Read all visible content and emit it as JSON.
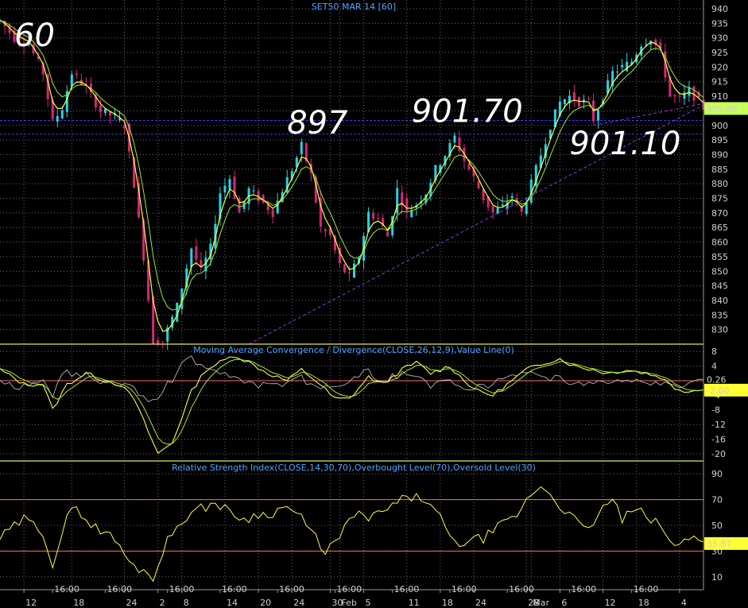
{
  "colors": {
    "background": "#000000",
    "grid": "#6a6a6a",
    "panel_border": "#e8e84a",
    "bull": "#27d3e6",
    "bear": "#d6287a",
    "ma_fast": "#ffff33",
    "ma_slow": "#9be83a",
    "signal": "#c9c9c9",
    "level_line": "#ff6a6a",
    "dashed": "#3a3af0",
    "trend": "#8a3ad9",
    "last_price_box": "#c9ff5a",
    "rsi_line": "#ffff33"
  },
  "chart_data": [
    {
      "type": "candlestick",
      "title": "SET50 MAR 14 [60]",
      "ylim": [
        825,
        943
      ],
      "yticks": [
        830,
        835,
        840,
        845,
        850,
        855,
        860,
        865,
        870,
        875,
        880,
        885,
        890,
        895,
        900,
        905,
        910,
        915,
        920,
        925,
        930,
        935,
        940
      ],
      "last_value": "905.80",
      "horizontal_levels": [
        901.7,
        897
      ],
      "annotations": [
        {
          "text": "60",
          "x": 3,
          "y": 931
        },
        {
          "text": "897",
          "x": 60,
          "y": 901
        },
        {
          "text": "901.70",
          "x": 86,
          "y": 905
        },
        {
          "text": "901.10",
          "x": 119,
          "y": 894
        }
      ],
      "trendlines": [
        {
          "from": [
            52,
            825
          ],
          "to": [
            147,
            907
          ]
        },
        {
          "from": [
            124,
            900
          ],
          "to": [
            147,
            907.5
          ]
        }
      ],
      "path_anchors": [
        [
          0,
          936
        ],
        [
          3,
          930
        ],
        [
          6,
          928
        ],
        [
          9,
          918
        ],
        [
          11,
          901
        ],
        [
          13,
          906
        ],
        [
          15,
          918
        ],
        [
          18,
          913
        ],
        [
          21,
          905
        ],
        [
          24,
          903
        ],
        [
          26,
          900
        ],
        [
          28,
          880
        ],
        [
          30,
          855
        ],
        [
          32,
          826
        ],
        [
          34,
          826
        ],
        [
          37,
          838
        ],
        [
          40,
          858
        ],
        [
          42,
          850
        ],
        [
          44,
          858
        ],
        [
          46,
          877
        ],
        [
          48,
          882
        ],
        [
          50,
          870
        ],
        [
          52,
          878
        ],
        [
          54,
          875
        ],
        [
          57,
          870
        ],
        [
          59,
          878
        ],
        [
          61,
          885
        ],
        [
          63,
          893
        ],
        [
          65,
          883
        ],
        [
          67,
          865
        ],
        [
          69,
          862
        ],
        [
          71,
          852
        ],
        [
          73,
          848
        ],
        [
          75,
          855
        ],
        [
          77,
          870
        ],
        [
          79,
          868
        ],
        [
          81,
          862
        ],
        [
          83,
          878
        ],
        [
          85,
          870
        ],
        [
          87,
          873
        ],
        [
          89,
          877
        ],
        [
          91,
          885
        ],
        [
          93,
          890
        ],
        [
          95,
          896
        ],
        [
          97,
          888
        ],
        [
          99,
          882
        ],
        [
          101,
          875
        ],
        [
          103,
          870
        ],
        [
          105,
          872
        ],
        [
          107,
          876
        ],
        [
          109,
          870
        ],
        [
          111,
          880
        ],
        [
          113,
          890
        ],
        [
          115,
          900
        ],
        [
          117,
          908
        ],
        [
          119,
          910
        ],
        [
          121,
          908
        ],
        [
          123,
          908
        ],
        [
          124,
          902
        ],
        [
          126,
          910
        ],
        [
          128,
          918
        ],
        [
          130,
          920
        ],
        [
          132,
          922
        ],
        [
          134,
          928
        ],
        [
          136,
          930
        ],
        [
          138,
          925
        ],
        [
          140,
          910
        ],
        [
          142,
          909
        ],
        [
          144,
          912
        ],
        [
          146,
          908
        ],
        [
          147,
          906
        ]
      ]
    },
    {
      "type": "line",
      "title": "Moving Average Convergence / Divergence(CLOSE,26,12,9),Value Line(0)",
      "ylim": [
        -22,
        10
      ],
      "yticks": [
        -20,
        -16,
        -12,
        -8,
        -4,
        0,
        4,
        8
      ],
      "value_labels": [
        "0.26",
        "-2.60"
      ],
      "anchors": [
        [
          0,
          3
        ],
        [
          5,
          -1
        ],
        [
          9,
          -1
        ],
        [
          11,
          -8
        ],
        [
          14,
          -1
        ],
        [
          18,
          2
        ],
        [
          22,
          0
        ],
        [
          25,
          -1
        ],
        [
          28,
          -5
        ],
        [
          31,
          -14
        ],
        [
          33,
          -20
        ],
        [
          36,
          -17
        ],
        [
          40,
          -3
        ],
        [
          43,
          3
        ],
        [
          46,
          5
        ],
        [
          49,
          7
        ],
        [
          52,
          5
        ],
        [
          56,
          2
        ],
        [
          60,
          0
        ],
        [
          63,
          3
        ],
        [
          66,
          0
        ],
        [
          70,
          -5
        ],
        [
          73,
          -5
        ],
        [
          77,
          1
        ],
        [
          80,
          -1
        ],
        [
          84,
          3
        ],
        [
          87,
          5
        ],
        [
          90,
          2
        ],
        [
          94,
          4
        ],
        [
          97,
          0
        ],
        [
          100,
          -3
        ],
        [
          103,
          -4
        ],
        [
          107,
          0
        ],
        [
          110,
          3
        ],
        [
          114,
          5
        ],
        [
          117,
          6
        ],
        [
          120,
          4
        ],
        [
          124,
          3
        ],
        [
          127,
          2
        ],
        [
          131,
          3
        ],
        [
          135,
          2
        ],
        [
          138,
          1
        ],
        [
          141,
          -2
        ],
        [
          144,
          -3
        ],
        [
          147,
          -2
        ]
      ]
    },
    {
      "type": "line",
      "title": "Relative Strength Index(CLOSE,14,30,70),Overbought Level(70),Oversold Level(30)",
      "ylim": [
        0,
        100
      ],
      "yticks": [
        10,
        30,
        50,
        70,
        90
      ],
      "levels": [
        70,
        30
      ],
      "value_label": "35.87",
      "anchors": [
        [
          0,
          40
        ],
        [
          5,
          55
        ],
        [
          9,
          45
        ],
        [
          11,
          20
        ],
        [
          14,
          55
        ],
        [
          16,
          65
        ],
        [
          19,
          50
        ],
        [
          22,
          45
        ],
        [
          25,
          35
        ],
        [
          27,
          20
        ],
        [
          30,
          15
        ],
        [
          32,
          10
        ],
        [
          35,
          38
        ],
        [
          38,
          55
        ],
        [
          42,
          63
        ],
        [
          45,
          68
        ],
        [
          48,
          60
        ],
        [
          51,
          55
        ],
        [
          54,
          58
        ],
        [
          57,
          60
        ],
        [
          60,
          65
        ],
        [
          63,
          55
        ],
        [
          66,
          40
        ],
        [
          68,
          30
        ],
        [
          71,
          40
        ],
        [
          74,
          60
        ],
        [
          77,
          55
        ],
        [
          80,
          60
        ],
        [
          83,
          68
        ],
        [
          86,
          72
        ],
        [
          89,
          70
        ],
        [
          92,
          55
        ],
        [
          95,
          35
        ],
        [
          98,
          38
        ],
        [
          101,
          40
        ],
        [
          104,
          48
        ],
        [
          107,
          55
        ],
        [
          109,
          62
        ],
        [
          111,
          75
        ],
        [
          113,
          80
        ],
        [
          115,
          75
        ],
        [
          117,
          65
        ],
        [
          119,
          60
        ],
        [
          121,
          50
        ],
        [
          123,
          45
        ],
        [
          125,
          60
        ],
        [
          128,
          70
        ],
        [
          130,
          55
        ],
        [
          133,
          62
        ],
        [
          136,
          55
        ],
        [
          139,
          45
        ],
        [
          141,
          32
        ],
        [
          143,
          38
        ],
        [
          145,
          44
        ],
        [
          147,
          38
        ]
      ]
    }
  ],
  "time_axis": {
    "labels": [
      {
        "text": "12",
        "x": 5
      },
      {
        "text": "16:00",
        "x": 11
      },
      {
        "text": "18",
        "x": 15
      },
      {
        "text": "16:00",
        "x": 22
      },
      {
        "text": "24",
        "x": 26
      },
      {
        "text": "2",
        "x": 33
      },
      {
        "text": "16:00",
        "x": 35
      },
      {
        "text": "8",
        "x": 38
      },
      {
        "text": "14",
        "x": 47
      },
      {
        "text": "16:00",
        "x": 46
      },
      {
        "text": "20",
        "x": 54
      },
      {
        "text": "16:00",
        "x": 58
      },
      {
        "text": "24",
        "x": 61
      },
      {
        "text": "30",
        "x": 69
      },
      {
        "text": "16:00",
        "x": 70
      },
      {
        "text": "Feb",
        "x": 71
      },
      {
        "text": "5",
        "x": 76
      },
      {
        "text": "11",
        "x": 85
      },
      {
        "text": "16:00",
        "x": 82
      },
      {
        "text": "18",
        "x": 92
      },
      {
        "text": "16:00",
        "x": 94
      },
      {
        "text": "24",
        "x": 99
      },
      {
        "text": "16:00",
        "x": 106
      },
      {
        "text": "28",
        "x": 110
      },
      {
        "text": "Mar",
        "x": 111
      },
      {
        "text": "6",
        "x": 117
      },
      {
        "text": "16:00",
        "x": 119
      },
      {
        "text": "12",
        "x": 126
      },
      {
        "text": "18",
        "x": 133
      },
      {
        "text": "16:00",
        "x": 132
      },
      {
        "text": "4",
        "x": 142
      }
    ]
  }
}
